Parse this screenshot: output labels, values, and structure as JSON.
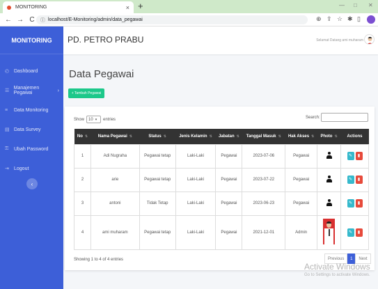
{
  "browser": {
    "tab_title": "MONITORING",
    "tab_close": "×",
    "new_tab": "+",
    "url": "localhost/E-Monitoring/admin/data_pegawai",
    "win_min": "—",
    "win_max": "□",
    "win_close": "✕"
  },
  "sidebar": {
    "brand": "MONITORING",
    "items": [
      {
        "label": "Dashboard",
        "icon": "dashboard-icon"
      },
      {
        "label": "Manajemen Pegawai",
        "icon": "users-icon"
      },
      {
        "label": "Data Monitoring",
        "icon": "list-icon"
      },
      {
        "label": "Data Survey",
        "icon": "clipboard-icon"
      },
      {
        "label": "Ubah Password",
        "icon": "lock-icon"
      },
      {
        "label": "Logout",
        "icon": "logout-icon"
      }
    ]
  },
  "topbar": {
    "company": "PD. PETRO PRABU",
    "welcome": "Selamat Datang ami muharam"
  },
  "page": {
    "title": "Data Pegawai",
    "add_button": "+ Tambah Pegawai"
  },
  "table_controls": {
    "show_label": "Show",
    "entries_value": "10",
    "entries_label": "entries",
    "search_label": "Search:"
  },
  "table": {
    "headers": [
      "No",
      "Nama Pegawai",
      "Status",
      "Jenis Kelamin",
      "Jabatan",
      "Tanggal Masuk",
      "Hak Akses",
      "Photo",
      "Actions"
    ],
    "rows": [
      {
        "no": "1",
        "nama": "Adi Nugraha",
        "status": "Pegawai tetap",
        "jk": "Laki-Laki",
        "jabatan": "Pegawai",
        "tanggal": "2023-07-06",
        "hak": "Pegawai"
      },
      {
        "no": "2",
        "nama": "arie",
        "status": "Pegawai tetap",
        "jk": "Laki-Laki",
        "jabatan": "Pegawai",
        "tanggal": "2023-07-22",
        "hak": "Pegawai"
      },
      {
        "no": "3",
        "nama": "antoni",
        "status": "Tidak Tetap",
        "jk": "Laki-Laki",
        "jabatan": "Pegawai",
        "tanggal": "2023-06-23",
        "hak": "Pegawai"
      },
      {
        "no": "4",
        "nama": "ami muharam",
        "status": "Pegawai tetap",
        "jk": "Laki-Laki",
        "jabatan": "Pegawai",
        "tanggal": "2021-12-01",
        "hak": "Admin"
      }
    ]
  },
  "footer": {
    "info": "Showing 1 to 4 of 4 entries",
    "previous": "Previous",
    "page": "1",
    "next": "Next"
  },
  "watermark": {
    "title": "Activate Windows",
    "subtitle": "Go to Settings to activate Windows."
  },
  "colors": {
    "sidebar": "#3d5fd8",
    "add_button": "#1cc88a",
    "edit": "#36b9cc",
    "delete": "#e74a3b",
    "table_header": "#333333"
  }
}
